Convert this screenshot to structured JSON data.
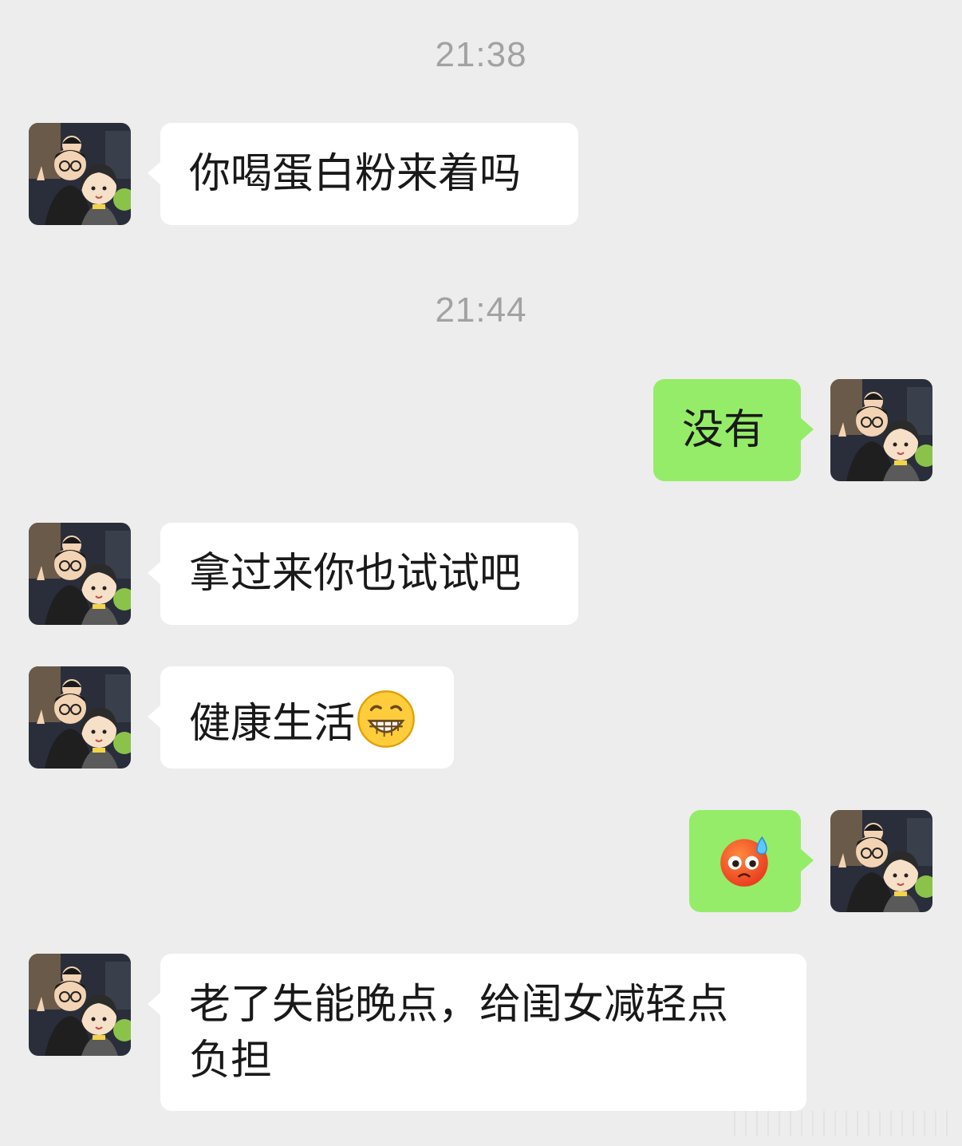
{
  "chat": {
    "timestamps": [
      "21:38",
      "21:44"
    ],
    "messages": [
      {
        "side": "left",
        "text": "你喝蛋白粉来着吗",
        "avatar": "cartoon-family-avatar"
      },
      {
        "side": "right",
        "text": "没有",
        "avatar": "cartoon-family-avatar"
      },
      {
        "side": "left",
        "text": "拿过来你也试试吧",
        "avatar": "cartoon-family-avatar"
      },
      {
        "side": "left",
        "text": "健康生活",
        "emoji": "grinning-face-emoji",
        "avatar": "cartoon-family-avatar"
      },
      {
        "side": "right",
        "text": "",
        "emoji": "sweating-red-face-emoji",
        "avatar": "cartoon-family-avatar"
      },
      {
        "side": "left",
        "text": "老了失能晚点，给闺女减轻点\n负担",
        "avatar": "cartoon-family-avatar"
      }
    ]
  },
  "colors": {
    "background": "#ededed",
    "incoming_bubble": "#ffffff",
    "outgoing_bubble": "#95ec69",
    "timestamp": "#a2a2a2",
    "message_text": "#191919"
  }
}
